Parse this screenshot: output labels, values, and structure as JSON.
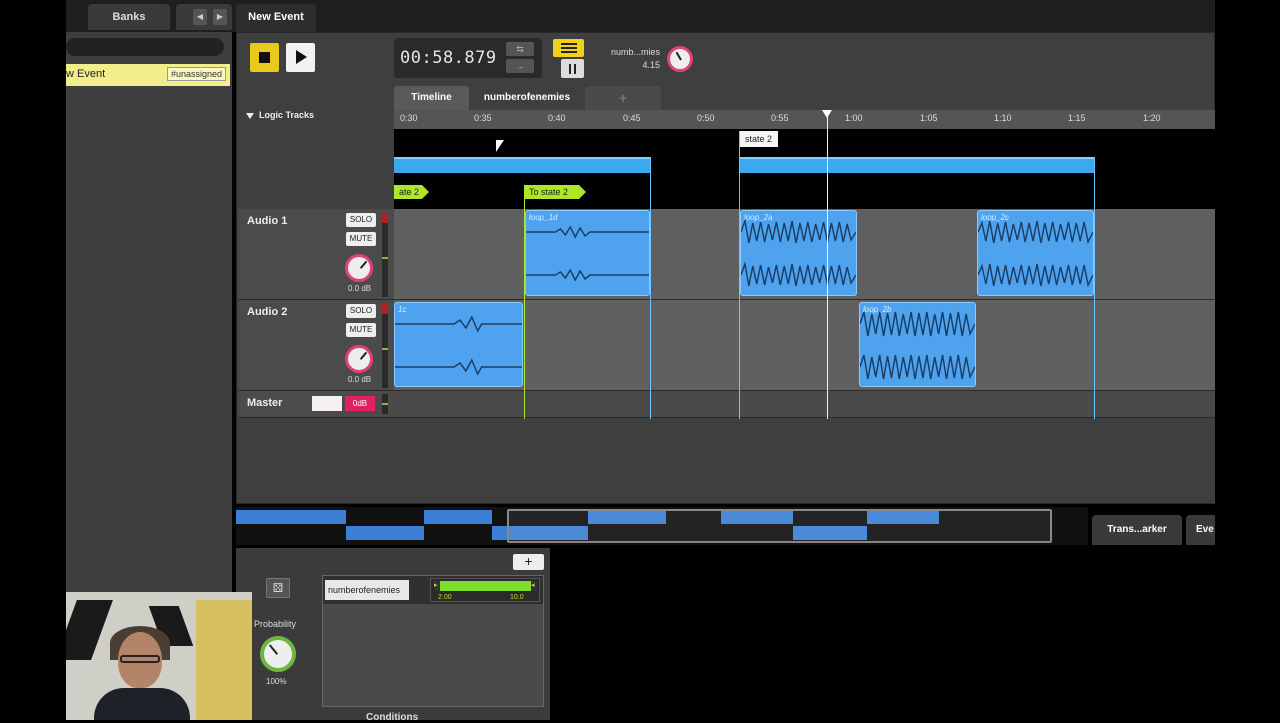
{
  "left_panel": {
    "tab_banks": "Banks",
    "nav_prev": "◀",
    "nav_next": "▶",
    "event_name": "w Event",
    "event_tag": "#unassigned"
  },
  "event_tab": "New Event",
  "transport": {
    "time": "00:58.879",
    "param_name": "numb...mies",
    "param_value": "4.15"
  },
  "timeline_tabs": [
    "Timeline",
    "numberofenemies",
    "+"
  ],
  "logic_tracks_label": "Logic Tracks",
  "ruler": [
    "0:30",
    "0:35",
    "0:40",
    "0:45",
    "0:50",
    "0:55",
    "1:00",
    "1:05",
    "1:10",
    "1:15",
    "1:20"
  ],
  "markers": {
    "state2_left": "ate 2",
    "to_state2": "To state 2",
    "state2_destination": "state 2"
  },
  "tracks": [
    {
      "name": "Audio 1",
      "solo": "SOLO",
      "mute": "MUTE",
      "volume": "0.0 dB",
      "clips": [
        "loop_1d",
        "loop_2a",
        "loop_2c"
      ]
    },
    {
      "name": "Audio 2",
      "solo": "SOLO",
      "mute": "MUTE",
      "volume": "0.0 dB",
      "clips": [
        "1c",
        "loop_2b"
      ]
    }
  ],
  "master": {
    "name": "Master",
    "volume": "0dB"
  },
  "bottom_tabs": {
    "transition_marker": "Trans...arker",
    "event": "Eve"
  },
  "conditions": {
    "add": "+",
    "probability_label": "Probability",
    "probability_value": "100%",
    "parameter": "numberofenemies",
    "range_min": "2.00",
    "range_max": "10.0",
    "title": "Conditions"
  },
  "colors": {
    "accent_yellow": "#f0d21a",
    "clip_blue": "#4fa3ee",
    "marker_green": "#aee62a",
    "knob_pink": "#e04080",
    "event_highlight": "#f2ee8c"
  }
}
